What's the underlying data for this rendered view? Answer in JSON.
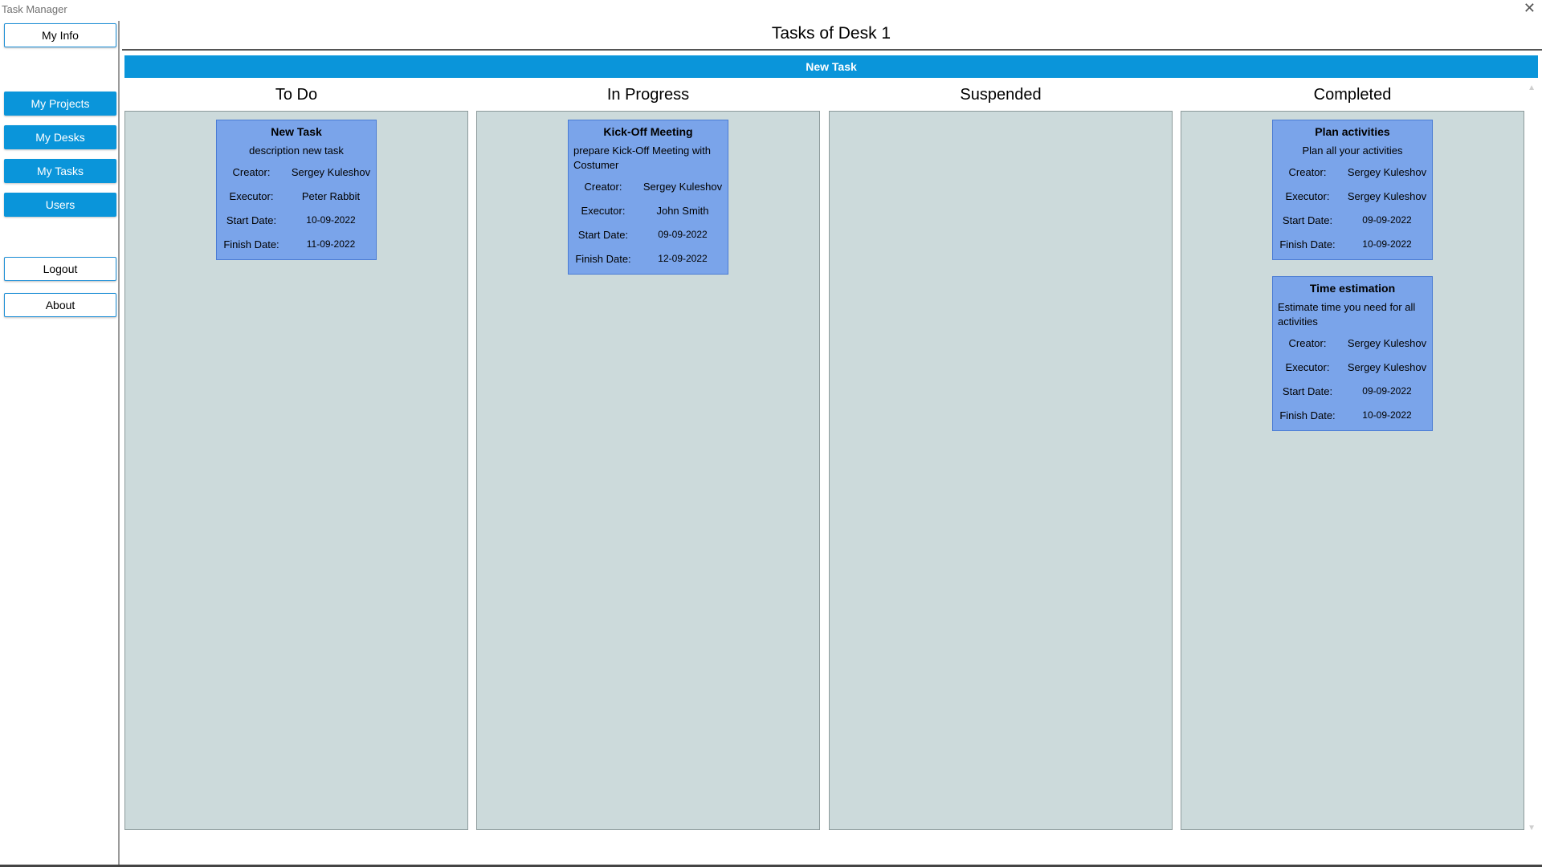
{
  "window": {
    "title": "Task Manager",
    "close_symbol": "✕"
  },
  "sidebar": {
    "my_info": "My Info",
    "my_projects": "My Projects",
    "my_desks": "My Desks",
    "my_tasks": "My Tasks",
    "users": "Users",
    "logout": "Logout",
    "about": "About"
  },
  "header": {
    "title": "Tasks of Desk 1",
    "new_task": "New Task"
  },
  "labels": {
    "creator": "Creator:",
    "executor": "Executor:",
    "start": "Start Date:",
    "finish": "Finish Date:"
  },
  "columns": [
    {
      "title": "To Do"
    },
    {
      "title": "In Progress"
    },
    {
      "title": "Suspended"
    },
    {
      "title": "Completed"
    }
  ],
  "cards": {
    "todo_0": {
      "title": "New Task",
      "description": "description new task",
      "creator": "Sergey Kuleshov",
      "executor": "Peter Rabbit",
      "start": "10-09-2022",
      "finish": "11-09-2022"
    },
    "progress_0": {
      "title": "Kick-Off Meeting",
      "description": "prepare Kick-Off Meeting with Costumer",
      "creator": "Sergey Kuleshov",
      "executor": "John Smith",
      "start": "09-09-2022",
      "finish": "12-09-2022"
    },
    "completed_0": {
      "title": "Plan activities",
      "description": "Plan all your activities",
      "creator": "Sergey Kuleshov",
      "executor": "Sergey Kuleshov",
      "start": "09-09-2022",
      "finish": "10-09-2022"
    },
    "completed_1": {
      "title": "Time estimation",
      "description": "Estimate time you need for all activities",
      "creator": "Sergey Kuleshov",
      "executor": "Sergey Kuleshov",
      "start": "09-09-2022",
      "finish": "10-09-2022"
    }
  },
  "colors": {
    "accent": "#0a95da",
    "card": "#7aa4ea",
    "column_bg": "#ccdadb"
  }
}
